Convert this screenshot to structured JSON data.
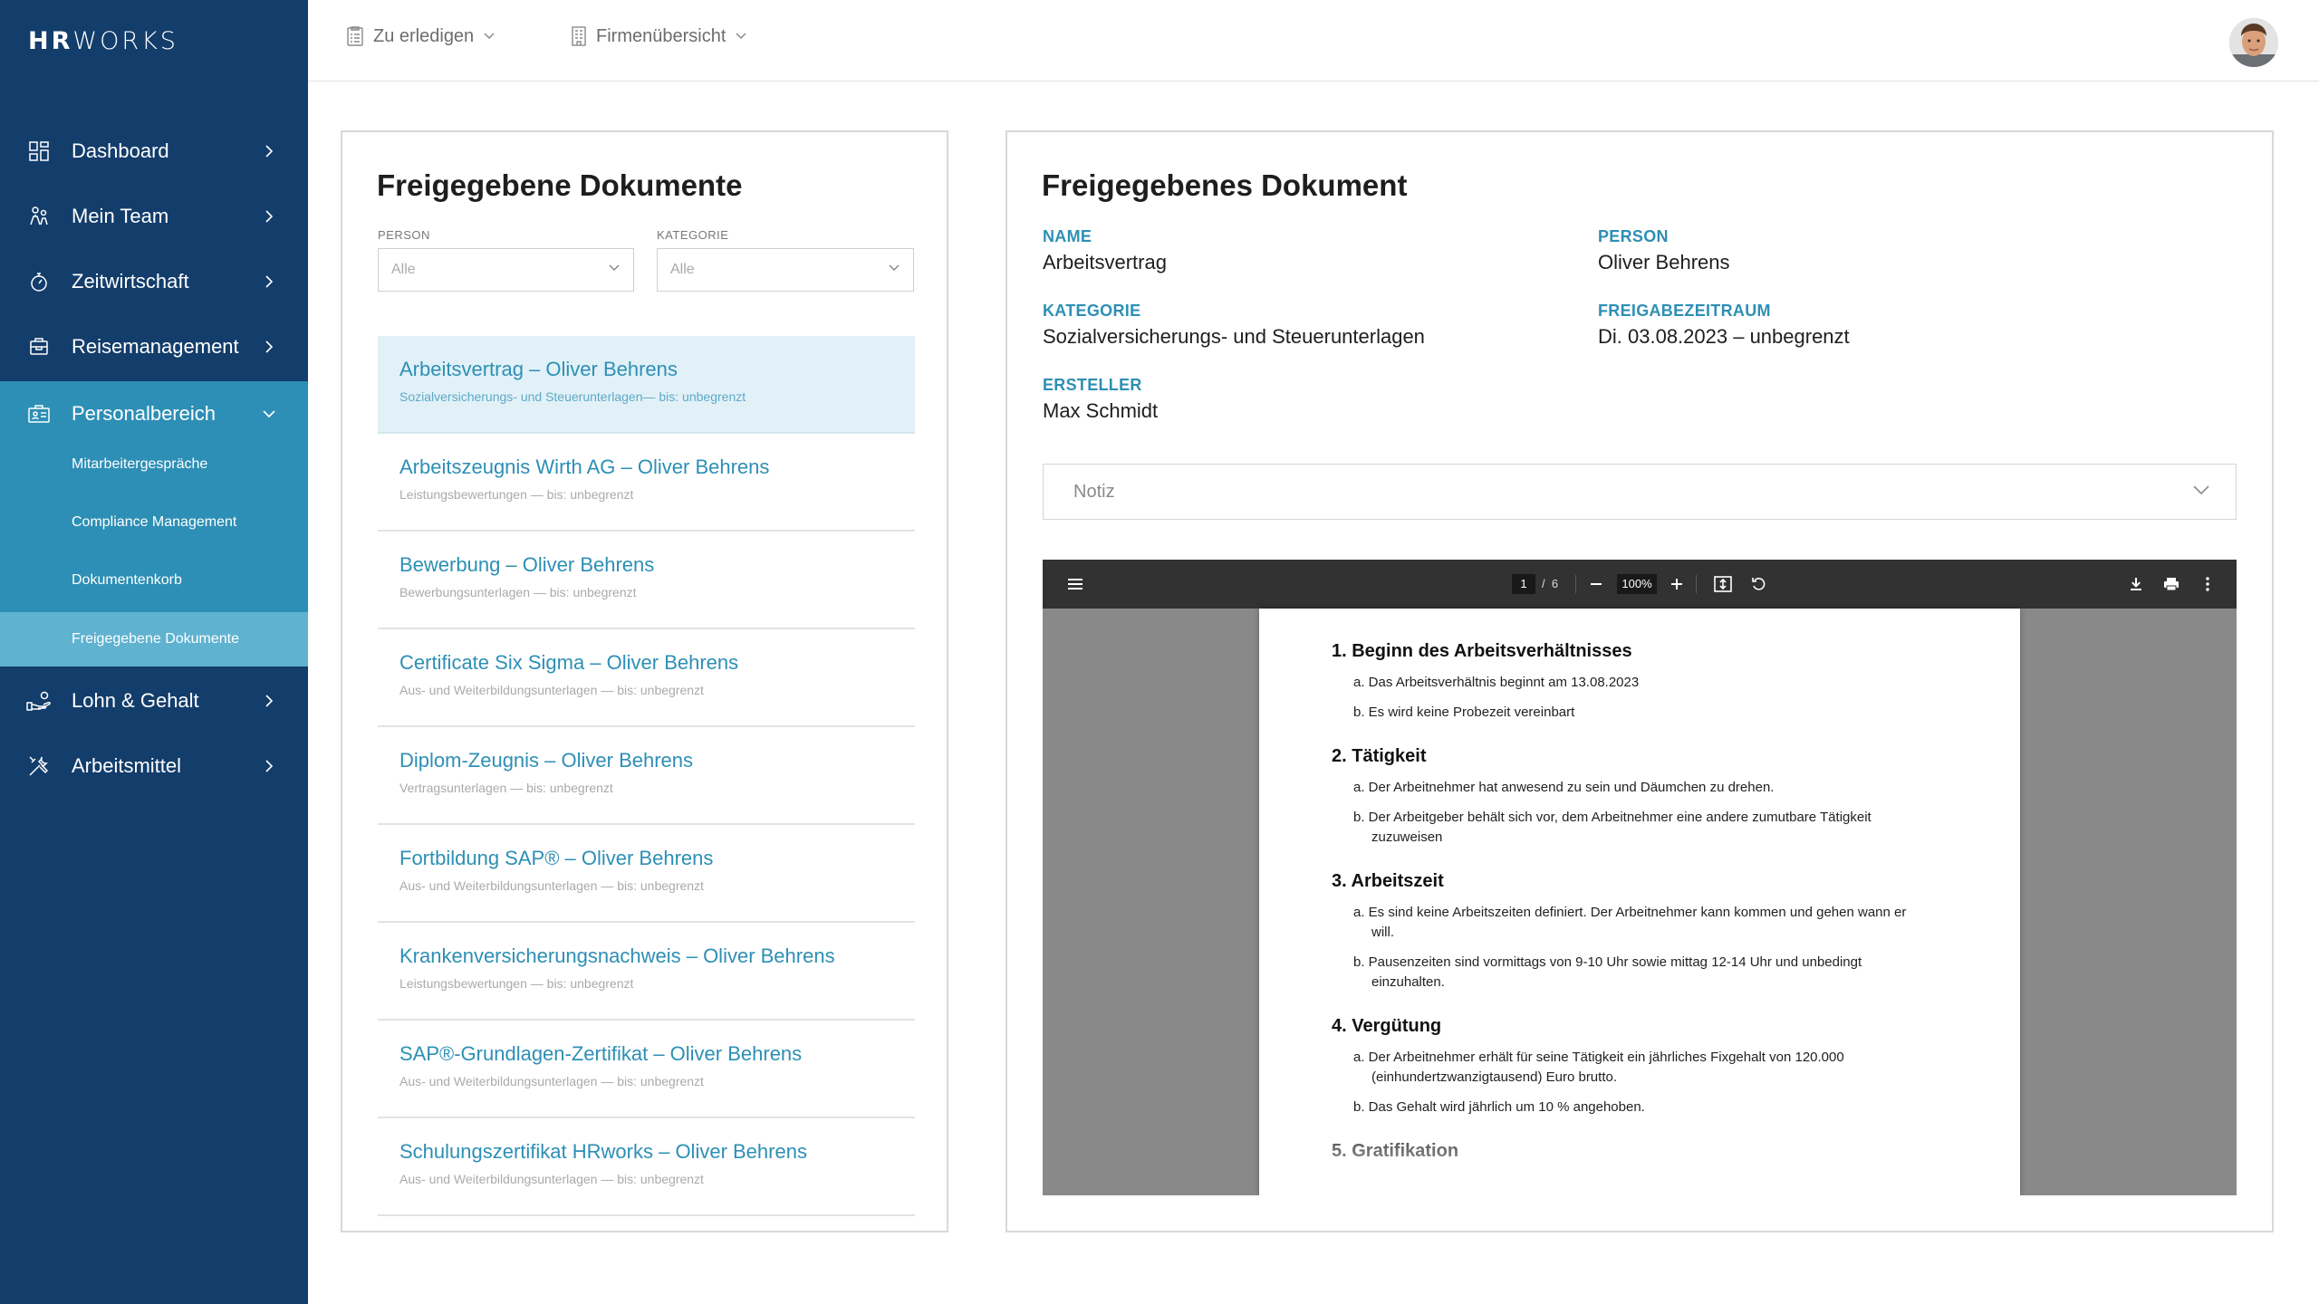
{
  "app": {
    "logo_bold": "HR",
    "logo_light": "WORKS"
  },
  "sidebar": {
    "items": [
      {
        "label": "Dashboard",
        "icon": "dashboard-icon"
      },
      {
        "label": "Mein Team",
        "icon": "team-icon"
      },
      {
        "label": "Zeitwirtschaft",
        "icon": "stopwatch-icon"
      },
      {
        "label": "Reisemanagement",
        "icon": "travel-icon"
      },
      {
        "label": "Personalbereich",
        "icon": "personnel-icon"
      },
      {
        "label": "Lohn & Gehalt",
        "icon": "salary-icon"
      },
      {
        "label": "Arbeitsmittel",
        "icon": "tools-icon"
      }
    ],
    "submenu": [
      {
        "label": "Mitarbeitergespräche"
      },
      {
        "label": "Compliance Management"
      },
      {
        "label": "Dokumentenkorb"
      },
      {
        "label": "Freigegebene Dokumente"
      }
    ]
  },
  "topbar": {
    "todo": "Zu erledigen",
    "company": "Firmenübersicht"
  },
  "list_panel": {
    "title": "Freigegebene Dokumente",
    "person_label": "PERSON",
    "person_value": "Alle",
    "category_label": "KATEGORIE",
    "category_value": "Alle",
    "documents": [
      {
        "title": "Arbeitsvertrag – Oliver Behrens",
        "subtitle": "Sozialversicherungs- und Steuerunterlagen— bis: unbegrenzt"
      },
      {
        "title": "Arbeitszeugnis Wirth AG – Oliver Behrens",
        "subtitle": "Leistungsbewertungen — bis: unbegrenzt"
      },
      {
        "title": "Bewerbung – Oliver Behrens",
        "subtitle": "Bewerbungsunterlagen — bis: unbegrenzt"
      },
      {
        "title": "Certificate Six Sigma – Oliver Behrens",
        "subtitle": "Aus- und Weiterbildungsunterlagen — bis: unbegrenzt"
      },
      {
        "title": "Diplom-Zeugnis – Oliver Behrens",
        "subtitle": "Vertragsunterlagen — bis: unbegrenzt"
      },
      {
        "title": "Fortbildung SAP® – Oliver Behrens",
        "subtitle": "Aus- und Weiterbildungsunterlagen — bis: unbegrenzt"
      },
      {
        "title": "Krankenversicherungsnachweis – Oliver Behrens",
        "subtitle": "Leistungsbewertungen — bis: unbegrenzt"
      },
      {
        "title": "SAP®-Grundlagen-Zertifikat – Oliver Behrens",
        "subtitle": "Aus- und Weiterbildungsunterlagen — bis: unbegrenzt"
      },
      {
        "title": "Schulungszertifikat HRworks – Oliver Behrens",
        "subtitle": "Aus- und Weiterbildungsunterlagen — bis: unbegrenzt"
      }
    ]
  },
  "detail_panel": {
    "title": "Freigegebenes Dokument",
    "name_label": "NAME",
    "name_value": "Arbeitsvertrag",
    "person_label": "PERSON",
    "person_value": "Oliver Behrens",
    "category_label": "KATEGORIE",
    "category_value": "Sozialversicherungs- und Steuerunterlagen",
    "period_label": "FREIGABEZEITRAUM",
    "period_value": "Di. 03.08.2023 – unbegrenzt",
    "creator_label": "ERSTELLER",
    "creator_value": "Max Schmidt",
    "note_label": "Notiz"
  },
  "pdf_viewer": {
    "current_page": "1",
    "page_sep": "/",
    "total_pages": "6",
    "zoom": "100%",
    "sections": [
      {
        "title": "1. Beginn des Arbeitsverhältnisses",
        "items": [
          "a. Das Arbeitsverhältnis beginnt am 13.08.2023",
          "b. Es wird keine Probezeit vereinbart"
        ]
      },
      {
        "title": "2. Tätigkeit",
        "items": [
          "a. Der Arbeitnehmer hat anwesend zu sein und Däumchen zu drehen.",
          "b. Der Arbeitgeber behält sich vor, dem Arbeitnehmer eine andere zumutbare Tätigkeit zuzuweisen"
        ]
      },
      {
        "title": "3. Arbeitszeit",
        "items": [
          "a. Es sind keine Arbeitszeiten definiert. Der Arbeitnehmer kann kommen und gehen wann er will.",
          "b. Pausenzeiten sind vormittags von 9-10 Uhr sowie mittag 12-14 Uhr und unbedingt einzuhalten."
        ]
      },
      {
        "title": "4. Vergütung",
        "items": [
          "a. Der Arbeitnehmer erhält für seine Tätigkeit ein jährliches Fixgehalt von 120.000 (einhundertzwanzigtausend) Euro brutto.",
          "b. Das Gehalt wird jährlich um 10 % angehoben."
        ]
      },
      {
        "title": "5. Gratifikation",
        "items": []
      }
    ]
  },
  "colors": {
    "sidebar": "#133d6b",
    "accent": "#2d8fb5",
    "submenu_active": "#5fb2d0"
  }
}
